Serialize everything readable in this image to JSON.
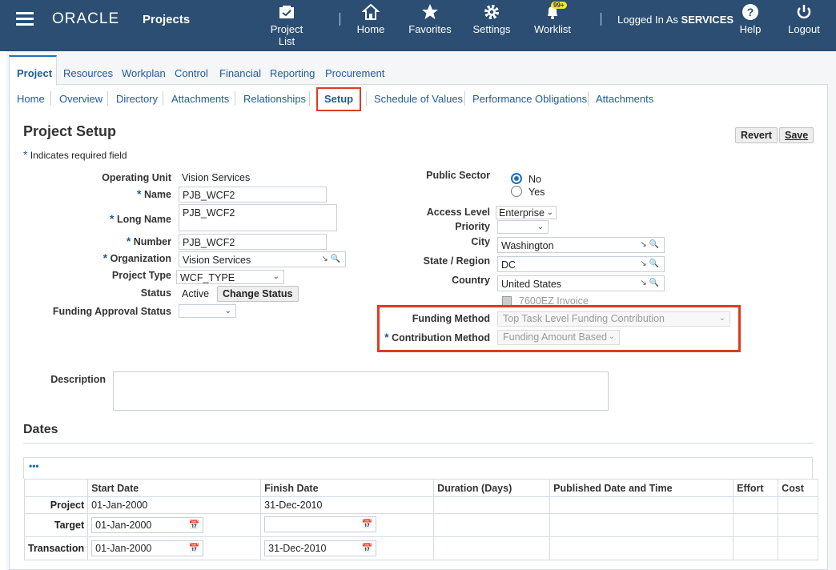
{
  "header": {
    "brand": "ORACLE",
    "product": "Projects",
    "nav": [
      {
        "label": "Project List",
        "icon": "project-list-icon"
      },
      {
        "label": "Home",
        "icon": "home-icon"
      },
      {
        "label": "Favorites",
        "icon": "star-icon"
      },
      {
        "label": "Settings",
        "icon": "gear-icon"
      },
      {
        "label": "Worklist",
        "icon": "bell-icon",
        "badge": "99+"
      }
    ],
    "logged_in_prefix": "Logged In As",
    "logged_in_user": "SERVICES",
    "help": "Help",
    "logout": "Logout"
  },
  "tabs": [
    "Project",
    "Resources",
    "Workplan",
    "Control",
    "Financial",
    "Reporting",
    "Procurement"
  ],
  "subtabs": [
    "Home",
    "Overview",
    "Directory",
    "Attachments",
    "Relationships",
    "Setup",
    "Schedule of Values",
    "Performance Obligations",
    "Attachments"
  ],
  "page": {
    "title": "Project Setup",
    "required_note": "Indicates required field",
    "revert": "Revert",
    "save": "Save"
  },
  "left_form": {
    "operating_unit_label": "Operating Unit",
    "operating_unit": "Vision Services",
    "name_label": "Name",
    "name": "PJB_WCF2",
    "long_name_label": "Long Name",
    "long_name": "PJB_WCF2",
    "number_label": "Number",
    "number": "PJB_WCF2",
    "organization_label": "Organization",
    "organization": "Vision Services",
    "project_type_label": "Project Type",
    "project_type": "WCF_TYPE",
    "status_label": "Status",
    "status": "Active",
    "change_status": "Change Status",
    "funding_approval_label": "Funding Approval Status",
    "funding_approval": ""
  },
  "right_form": {
    "public_sector_label": "Public Sector",
    "public_sector_no": "No",
    "public_sector_yes": "Yes",
    "access_level_label": "Access Level",
    "access_level": "Enterprise",
    "priority_label": "Priority",
    "priority": "",
    "city_label": "City",
    "city": "Washington",
    "state_label": "State / Region",
    "state": "DC",
    "country_label": "Country",
    "country": "United States",
    "invoice_checkbox": "7600EZ Invoice",
    "funding_method_label": "Funding Method",
    "funding_method": "Top Task Level Funding Contribution",
    "contribution_method_label": "Contribution Method",
    "contribution_method": "Funding Amount Based"
  },
  "description_label": "Description",
  "dates": {
    "title": "Dates",
    "more": "•••",
    "columns": [
      "",
      "Start Date",
      "Finish Date",
      "Duration (Days)",
      "Published Date and Time",
      "Effort",
      "Cost"
    ],
    "rows": [
      {
        "label": "Project",
        "start": "01-Jan-2000",
        "finish": "31-Dec-2010"
      },
      {
        "label": "Target",
        "start": "01-Jan-2000",
        "finish": ""
      },
      {
        "label": "Transaction",
        "start": "01-Jan-2000",
        "finish": "31-Dec-2010"
      }
    ]
  }
}
